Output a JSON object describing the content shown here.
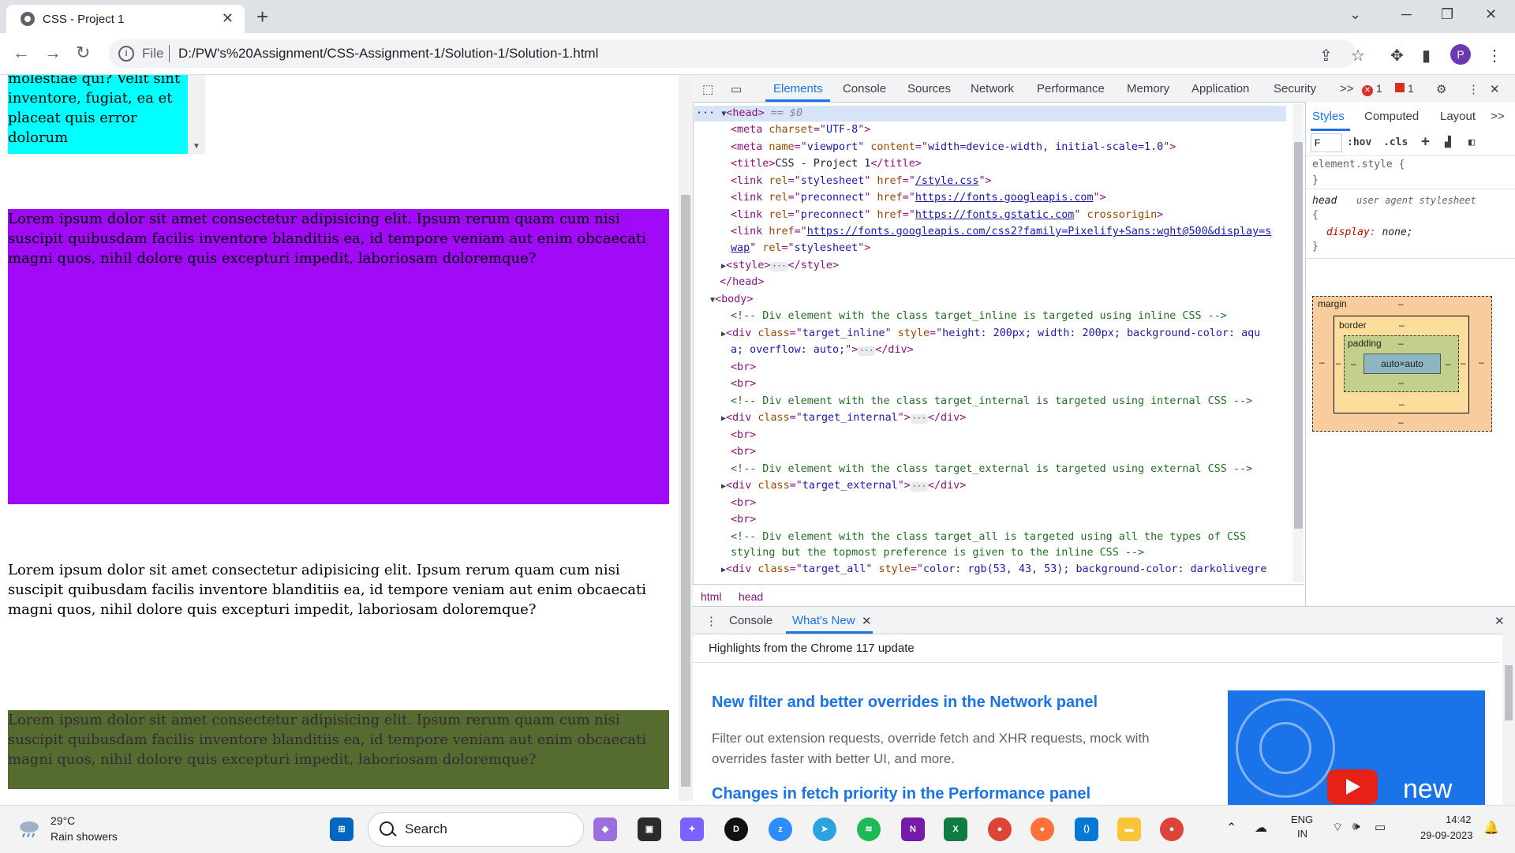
{
  "browser": {
    "tab_title": "CSS - Project 1",
    "tab_close": "✕",
    "new_tab": "+",
    "file_label": "File",
    "url": "D:/PW's%20Assignment/CSS-Assignment-1/Solution-1/Solution-1.html",
    "avatar_letter": "P"
  },
  "page": {
    "inline_text": "molestiae qui? Velit sint inventore, fugiat, ea et placeat quis error dolorum",
    "lorem": "Lorem ipsum dolor sit amet consectetur adipisicing elit. Ipsum rerum quam cum nisi suscipit quibusdam facilis inventore blanditiis ea, id tempore veniam aut enim obcaecati magni quos, nihil dolore quis excepturi impedit, laboriosam doloremque?",
    "colors": {
      "inline_bg": "#00ffff",
      "internal_bg": "#a00af6",
      "all_bg": "#556b2f",
      "all_text": "#352b35"
    }
  },
  "devtools": {
    "tabs": [
      "Elements",
      "Console",
      "Sources",
      "Network",
      "Performance",
      "Memory",
      "Application",
      "Security"
    ],
    "more": ">>",
    "error_count": "1",
    "issue_count": "1",
    "dom": {
      "head_open": "<head>",
      "head_marker": "== $0",
      "meta_charset": "UTF-8",
      "meta_name": "viewport",
      "meta_content": "width=device-width, initial-scale=1.0",
      "title_text": "CSS - Project 1",
      "link1_rel": "stylesheet",
      "link1_href": "/style.css",
      "link2_rel": "preconnect",
      "link2_href": "https://fonts.googleapis.com",
      "link3_rel": "preconnect",
      "link3_href": "https://fonts.gstatic.com",
      "link4_href_a": "https://fonts.googleapis.com/css2?family=Pixelify+Sans:wght@500&display=s",
      "link4_href_b": "wap",
      "comment_inline": "<!-- Div element with the class target_inline is targeted using inline CSS -->",
      "inline_class": "target_inline",
      "inline_style_a": "height: 200px; width: 200px; background-color: aqu",
      "inline_style_b": "a; overflow: auto;",
      "comment_internal": "<!-- Div element with the class target_internal is targeted using internal CSS -->",
      "internal_class": "target_internal",
      "comment_external": "<!-- Div element with the class target_external is targeted using external CSS -->",
      "external_class": "target_external",
      "comment_all_a": "<!-- Div element with the class target_all is targeted using all the types of CSS",
      "comment_all_b": "styling but the topmost preference is given to the inline CSS -->",
      "all_class": "target_all",
      "all_style": "color: rgb(53, 43, 53); background-color: darkolivegre"
    },
    "breadcrumbs": [
      "html",
      "head"
    ],
    "styles": {
      "tabs": [
        "Styles",
        "Computed",
        "Layout"
      ],
      "filter": "F",
      "hov": ":hov",
      "cls": ".cls",
      "element_style": "element.style {",
      "close_brace": "}",
      "head_selector": "head",
      "head_origin": "user agent stylesheet",
      "open_brace": "{",
      "prop_name": "display",
      "prop_value": "none;",
      "box": {
        "margin": "margin",
        "border": "border",
        "padding": "padding",
        "content": "auto×auto",
        "dash": "–"
      }
    },
    "drawer": {
      "tabs": [
        "Console",
        "What's New"
      ],
      "highlights": "Highlights from the Chrome 117 update",
      "h1": "New filter and better overrides in the Network panel",
      "p1": "Filter out extension requests, override fetch and XHR requests, mock with overrides faster with better UI, and more.",
      "h2": "Changes in fetch priority in the Performance panel",
      "promo_word": "new"
    }
  },
  "taskbar": {
    "temp": "29°C",
    "weather": "Rain showers",
    "search": "Search",
    "lang1": "ENG",
    "lang2": "IN",
    "time": "14:42",
    "date": "29-09-2023"
  }
}
